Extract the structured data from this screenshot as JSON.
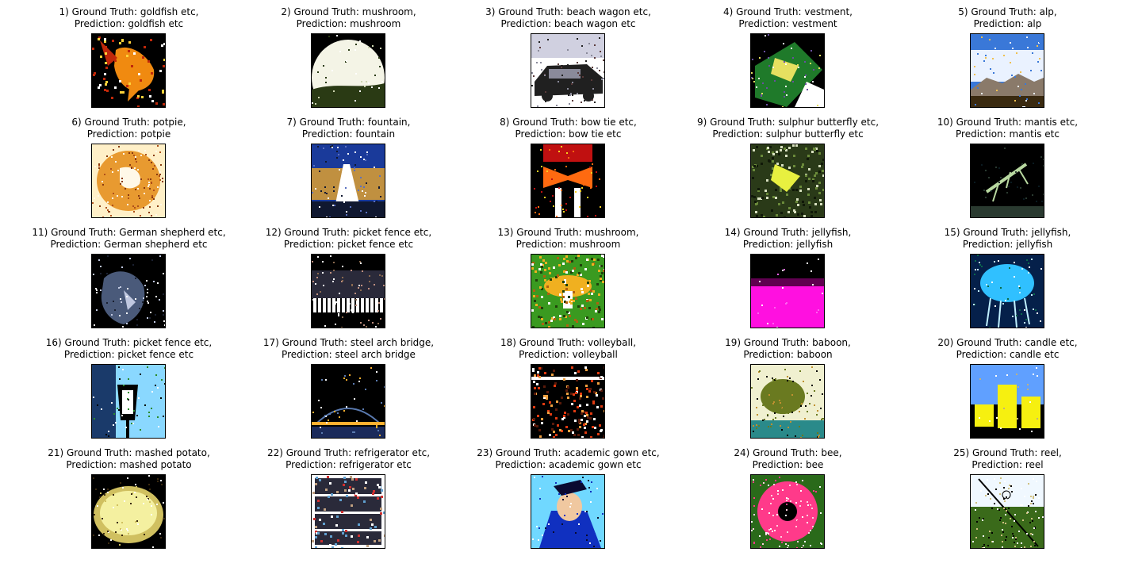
{
  "items": [
    {
      "caption_line1": "1) Ground Truth: goldfish etc,",
      "caption_line2": "Prediction: goldfish etc",
      "thumb_kind": "goldfish",
      "colors": [
        "#000000",
        "#f08a10",
        "#ffd23a",
        "#c0280a",
        "#ffffff"
      ]
    },
    {
      "caption_line1": "2) Ground Truth: mushroom,",
      "caption_line2": "Prediction: mushroom",
      "thumb_kind": "mushroom-dome",
      "colors": [
        "#000000",
        "#f4f4e6",
        "#cdd6b0",
        "#2a3a14",
        "#ffffff"
      ]
    },
    {
      "caption_line1": "3) Ground Truth: beach wagon etc,",
      "caption_line2": "Prediction: beach wagon etc",
      "thumb_kind": "car",
      "colors": [
        "#ffffff",
        "#202020",
        "#8a8a9a",
        "#5a3a3a",
        "#d0d0e0"
      ]
    },
    {
      "caption_line1": "4) Ground Truth: vestment,",
      "caption_line2": "Prediction: vestment",
      "thumb_kind": "vestment",
      "colors": [
        "#000000",
        "#1f7a2a",
        "#e6e060",
        "#ffffff",
        "#6a50a0"
      ]
    },
    {
      "caption_line1": "5) Ground Truth: alp,",
      "caption_line2": "Prediction: alp",
      "thumb_kind": "landscape",
      "colors": [
        "#3a78d8",
        "#eaf2ff",
        "#8a7a6a",
        "#3a2a10",
        "#f0c050"
      ]
    },
    {
      "caption_line1": "6) Ground Truth: potpie,",
      "caption_line2": "Prediction: potpie",
      "thumb_kind": "potpie",
      "colors": [
        "#fff0c8",
        "#e89a30",
        "#b0501a",
        "#fff8e8",
        "#8a3a10"
      ]
    },
    {
      "caption_line1": "7) Ground Truth: fountain,",
      "caption_line2": "Prediction: fountain",
      "thumb_kind": "fountain",
      "colors": [
        "#1a3a9a",
        "#ffffff",
        "#c09040",
        "#101830",
        "#5a70c0"
      ]
    },
    {
      "caption_line1": "8) Ground Truth: bow tie etc,",
      "caption_line2": "Prediction: bow tie etc",
      "thumb_kind": "bowtie",
      "colors": [
        "#000000",
        "#ff6a10",
        "#f6d020",
        "#ffffff",
        "#c01010"
      ]
    },
    {
      "caption_line1": "9) Ground Truth: sulphur butterfly etc,",
      "caption_line2": "Prediction: sulphur butterfly etc",
      "thumb_kind": "butterfly",
      "colors": [
        "#2a3a18",
        "#e8f040",
        "#6a8a3a",
        "#d8e0c0",
        "#101808"
      ]
    },
    {
      "caption_line1": "10) Ground Truth: mantis etc,",
      "caption_line2": "Prediction: mantis etc",
      "thumb_kind": "mantis",
      "colors": [
        "#000000",
        "#b8d8a0",
        "#2a3a30",
        "#ffffff",
        "#0a1a20"
      ]
    },
    {
      "caption_line1": "11) Ground Truth: German shepherd etc,",
      "caption_line2": "Prediction: German shepherd etc",
      "thumb_kind": "dog",
      "colors": [
        "#000000",
        "#4a5a7a",
        "#c0c8e0",
        "#1a2030",
        "#ffffff"
      ]
    },
    {
      "caption_line1": "12) Ground Truth: picket fence etc,",
      "caption_line2": "Prediction: picket fence etc",
      "thumb_kind": "fence",
      "colors": [
        "#000000",
        "#ffffff",
        "#c09080",
        "#2a2a3a",
        "#8a6a50"
      ]
    },
    {
      "caption_line1": "13) Ground Truth: mushroom,",
      "caption_line2": "Prediction: mushroom",
      "thumb_kind": "mushroom-field",
      "colors": [
        "#3a9a20",
        "#f0b020",
        "#ffffff",
        "#b06010",
        "#20400a"
      ]
    },
    {
      "caption_line1": "14) Ground Truth: jellyfish,",
      "caption_line2": "Prediction: jellyfish",
      "thumb_kind": "jelly-magenta",
      "colors": [
        "#000000",
        "#ff10e0",
        "#ffffff",
        "#600050",
        "#ff60f0"
      ]
    },
    {
      "caption_line1": "15) Ground Truth: jellyfish,",
      "caption_line2": "Prediction: jellyfish",
      "thumb_kind": "jelly-blue",
      "colors": [
        "#05204a",
        "#30c0ff",
        "#c0f0ff",
        "#0a6a4a",
        "#ffffff"
      ]
    },
    {
      "caption_line1": "16) Ground Truth: picket fence etc,",
      "caption_line2": "Prediction: picket fence etc",
      "thumb_kind": "lantern",
      "colors": [
        "#8ad8ff",
        "#000000",
        "#ffffff",
        "#1a3a6a",
        "#2a8a2a"
      ]
    },
    {
      "caption_line1": "17) Ground Truth: steel arch bridge,",
      "caption_line2": "Prediction: steel arch bridge",
      "thumb_kind": "bridge",
      "colors": [
        "#000000",
        "#1a2a5a",
        "#ffb030",
        "#ffffff",
        "#5a7ab0"
      ]
    },
    {
      "caption_line1": "18) Ground Truth: volleyball,",
      "caption_line2": "Prediction: volleyball",
      "thumb_kind": "volleyball",
      "colors": [
        "#000000",
        "#e03a10",
        "#ffffff",
        "#f0a040",
        "#5a1a0a"
      ]
    },
    {
      "caption_line1": "19) Ground Truth: baboon,",
      "caption_line2": "Prediction: baboon",
      "thumb_kind": "baboon",
      "colors": [
        "#f0f0d0",
        "#6a7a20",
        "#2a8a8a",
        "#000000",
        "#c09030"
      ]
    },
    {
      "caption_line1": "20) Ground Truth: candle etc,",
      "caption_line2": "Prediction: candle etc",
      "thumb_kind": "candles",
      "colors": [
        "#60a0ff",
        "#f6f010",
        "#000000",
        "#ffffff",
        "#c0b080"
      ]
    },
    {
      "caption_line1": "21) Ground Truth: mashed potato,",
      "caption_line2": "Prediction: mashed potato",
      "thumb_kind": "potato",
      "colors": [
        "#000000",
        "#f4f0a0",
        "#d0c060",
        "#ffffff",
        "#3a2a10"
      ]
    },
    {
      "caption_line1": "22) Ground Truth: refrigerator etc,",
      "caption_line2": "Prediction: refrigerator etc",
      "thumb_kind": "fridge",
      "colors": [
        "#ffffff",
        "#2a2a3a",
        "#c0a080",
        "#60a0d0",
        "#d03030"
      ]
    },
    {
      "caption_line1": "23) Ground Truth: academic gown etc,",
      "caption_line2": "Prediction: academic gown etc",
      "thumb_kind": "gown",
      "colors": [
        "#70d8ff",
        "#1030c0",
        "#f0c8a0",
        "#0a0a30",
        "#ffffff"
      ]
    },
    {
      "caption_line1": "24) Ground Truth: bee,",
      "caption_line2": "Prediction: bee",
      "thumb_kind": "flower",
      "colors": [
        "#ff3a8a",
        "#ffd0e0",
        "#2a6a1a",
        "#000000",
        "#ffffff"
      ]
    },
    {
      "caption_line1": "25) Ground Truth: reel,",
      "caption_line2": "Prediction: reel",
      "thumb_kind": "reel",
      "colors": [
        "#f0f8ff",
        "#3a6a1a",
        "#000000",
        "#d0c080",
        "#ffffff"
      ]
    }
  ]
}
